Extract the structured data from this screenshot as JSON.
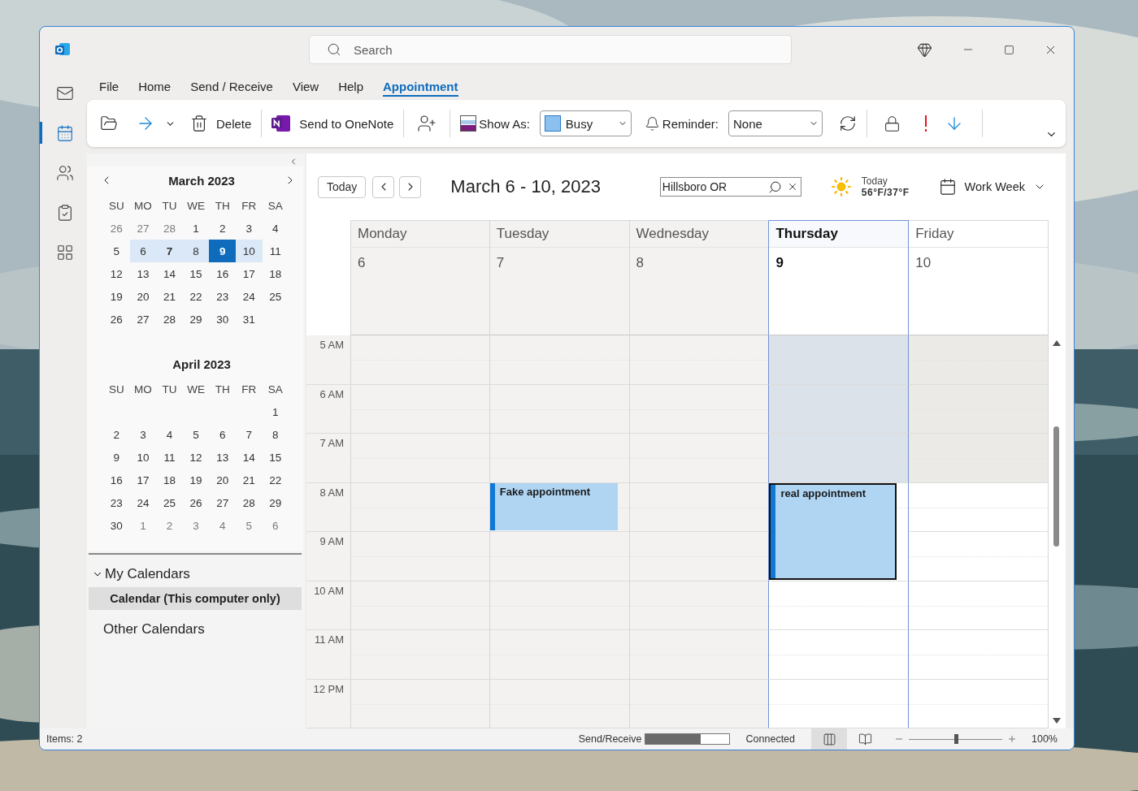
{
  "window": {
    "search": {
      "placeholder": "Search"
    }
  },
  "nav": [
    {
      "selected": false
    },
    {
      "selected": true
    },
    {
      "selected": false
    },
    {
      "selected": false
    },
    {
      "selected": false
    }
  ],
  "menu": [
    {
      "label": "File",
      "selected": false
    },
    {
      "label": "Home",
      "selected": false
    },
    {
      "label": "Send / Receive",
      "selected": false
    },
    {
      "label": "View",
      "selected": false
    },
    {
      "label": "Help",
      "selected": false
    },
    {
      "label": "Appointment",
      "selected": true
    }
  ],
  "ribbon": {
    "delete": "Delete",
    "onenote": "Send to OneNote",
    "show_as_label": "Show As:",
    "show_as_value": "Busy",
    "reminder_label": "Reminder:",
    "reminder_value": "None"
  },
  "sidebar": {
    "months": [
      {
        "title": "March 2023",
        "weekdays": [
          "SU",
          "MO",
          "TU",
          "WE",
          "TH",
          "FR",
          "SA"
        ],
        "weeks": [
          [
            {
              "d": "26",
              "kind": "muted"
            },
            {
              "d": "27",
              "kind": "muted"
            },
            {
              "d": "28",
              "kind": "muted"
            },
            {
              "d": "1",
              "kind": "plain"
            },
            {
              "d": "2",
              "kind": "plain"
            },
            {
              "d": "3",
              "kind": "plain"
            },
            {
              "d": "4",
              "kind": "plain"
            }
          ],
          [
            {
              "d": "5",
              "kind": "plain"
            },
            {
              "d": "6",
              "kind": "range"
            },
            {
              "d": "7",
              "kind": "range-bold"
            },
            {
              "d": "8",
              "kind": "range"
            },
            {
              "d": "9",
              "kind": "today"
            },
            {
              "d": "10",
              "kind": "range"
            },
            {
              "d": "11",
              "kind": "plain"
            }
          ],
          [
            {
              "d": "12",
              "kind": "plain"
            },
            {
              "d": "13",
              "kind": "plain"
            },
            {
              "d": "14",
              "kind": "plain"
            },
            {
              "d": "15",
              "kind": "plain"
            },
            {
              "d": "16",
              "kind": "plain"
            },
            {
              "d": "17",
              "kind": "plain"
            },
            {
              "d": "18",
              "kind": "plain"
            }
          ],
          [
            {
              "d": "19",
              "kind": "plain"
            },
            {
              "d": "20",
              "kind": "plain"
            },
            {
              "d": "21",
              "kind": "plain"
            },
            {
              "d": "22",
              "kind": "plain"
            },
            {
              "d": "23",
              "kind": "plain"
            },
            {
              "d": "24",
              "kind": "plain"
            },
            {
              "d": "25",
              "kind": "plain"
            }
          ],
          [
            {
              "d": "26",
              "kind": "plain"
            },
            {
              "d": "27",
              "kind": "plain"
            },
            {
              "d": "28",
              "kind": "plain"
            },
            {
              "d": "29",
              "kind": "plain"
            },
            {
              "d": "30",
              "kind": "plain"
            },
            {
              "d": "31",
              "kind": "plain"
            },
            {
              "kind": "blank"
            }
          ]
        ]
      },
      {
        "title": "April 2023",
        "weekdays": [
          "SU",
          "MO",
          "TU",
          "WE",
          "TH",
          "FR",
          "SA"
        ],
        "weeks": [
          [
            {
              "kind": "blank"
            },
            {
              "kind": "blank"
            },
            {
              "kind": "blank"
            },
            {
              "kind": "blank"
            },
            {
              "kind": "blank"
            },
            {
              "kind": "blank"
            },
            {
              "d": "1",
              "kind": "plain"
            }
          ],
          [
            {
              "d": "2",
              "kind": "plain"
            },
            {
              "d": "3",
              "kind": "plain"
            },
            {
              "d": "4",
              "kind": "plain"
            },
            {
              "d": "5",
              "kind": "plain"
            },
            {
              "d": "6",
              "kind": "plain"
            },
            {
              "d": "7",
              "kind": "plain"
            },
            {
              "d": "8",
              "kind": "plain"
            }
          ],
          [
            {
              "d": "9",
              "kind": "plain"
            },
            {
              "d": "10",
              "kind": "plain"
            },
            {
              "d": "11",
              "kind": "plain"
            },
            {
              "d": "12",
              "kind": "plain"
            },
            {
              "d": "13",
              "kind": "plain"
            },
            {
              "d": "14",
              "kind": "plain"
            },
            {
              "d": "15",
              "kind": "plain"
            }
          ],
          [
            {
              "d": "16",
              "kind": "plain"
            },
            {
              "d": "17",
              "kind": "plain"
            },
            {
              "d": "18",
              "kind": "plain"
            },
            {
              "d": "19",
              "kind": "plain"
            },
            {
              "d": "20",
              "kind": "plain"
            },
            {
              "d": "21",
              "kind": "plain"
            },
            {
              "d": "22",
              "kind": "plain"
            }
          ],
          [
            {
              "d": "23",
              "kind": "plain"
            },
            {
              "d": "24",
              "kind": "plain"
            },
            {
              "d": "25",
              "kind": "plain"
            },
            {
              "d": "26",
              "kind": "plain"
            },
            {
              "d": "27",
              "kind": "plain"
            },
            {
              "d": "28",
              "kind": "plain"
            },
            {
              "d": "29",
              "kind": "plain"
            }
          ],
          [
            {
              "d": "30",
              "kind": "plain"
            },
            {
              "d": "1",
              "kind": "muted"
            },
            {
              "d": "2",
              "kind": "muted"
            },
            {
              "d": "3",
              "kind": "muted"
            },
            {
              "d": "4",
              "kind": "muted"
            },
            {
              "d": "5",
              "kind": "muted"
            },
            {
              "d": "6",
              "kind": "muted"
            }
          ]
        ]
      }
    ],
    "groups": [
      {
        "label": "My Calendars",
        "expanded": true,
        "items": [
          {
            "label": "Calendar (This computer only)",
            "selected": true
          }
        ]
      },
      {
        "label": "Other Calendars",
        "expanded": false
      }
    ]
  },
  "calendar": {
    "today_button": "Today",
    "title": "March 6 - 10, 2023",
    "location": {
      "value": "Hillsboro OR"
    },
    "weather": {
      "label": "Today",
      "temps": "56°F/37°F"
    },
    "view": "Work Week",
    "days": [
      {
        "name": "Monday",
        "date": "6",
        "today": false,
        "past": true
      },
      {
        "name": "Tuesday",
        "date": "7",
        "today": false,
        "past": true
      },
      {
        "name": "Wednesday",
        "date": "8",
        "today": false,
        "past": true
      },
      {
        "name": "Thursday",
        "date": "9",
        "today": true,
        "past": false
      },
      {
        "name": "Friday",
        "date": "10",
        "today": false,
        "past": false
      }
    ],
    "hours": [
      {
        "label": "5 AM",
        "working": false
      },
      {
        "label": "6 AM",
        "working": false
      },
      {
        "label": "7 AM",
        "working": false
      },
      {
        "label": "8 AM",
        "working": true,
        "cells": [
          null,
          {
            "title": "Fake appointment",
            "selected": false,
            "kind": "one-hour"
          },
          null,
          {
            "title": "real appointment",
            "selected": true,
            "kind": "two-hour"
          },
          null
        ]
      },
      {
        "label": "9 AM",
        "working": true
      },
      {
        "label": "10 AM",
        "working": true
      },
      {
        "label": "11 AM",
        "working": true
      },
      {
        "label": "12 PM",
        "working": true
      }
    ]
  },
  "status_bar": {
    "items": "Items: 2",
    "send_receive": {
      "label": "Send/Receive",
      "level": 0.66
    },
    "connection": "Connected",
    "views": [
      {
        "selected": true
      },
      {
        "selected": false
      }
    ],
    "zoom": {
      "level": 0.5,
      "reading": "100%"
    }
  }
}
